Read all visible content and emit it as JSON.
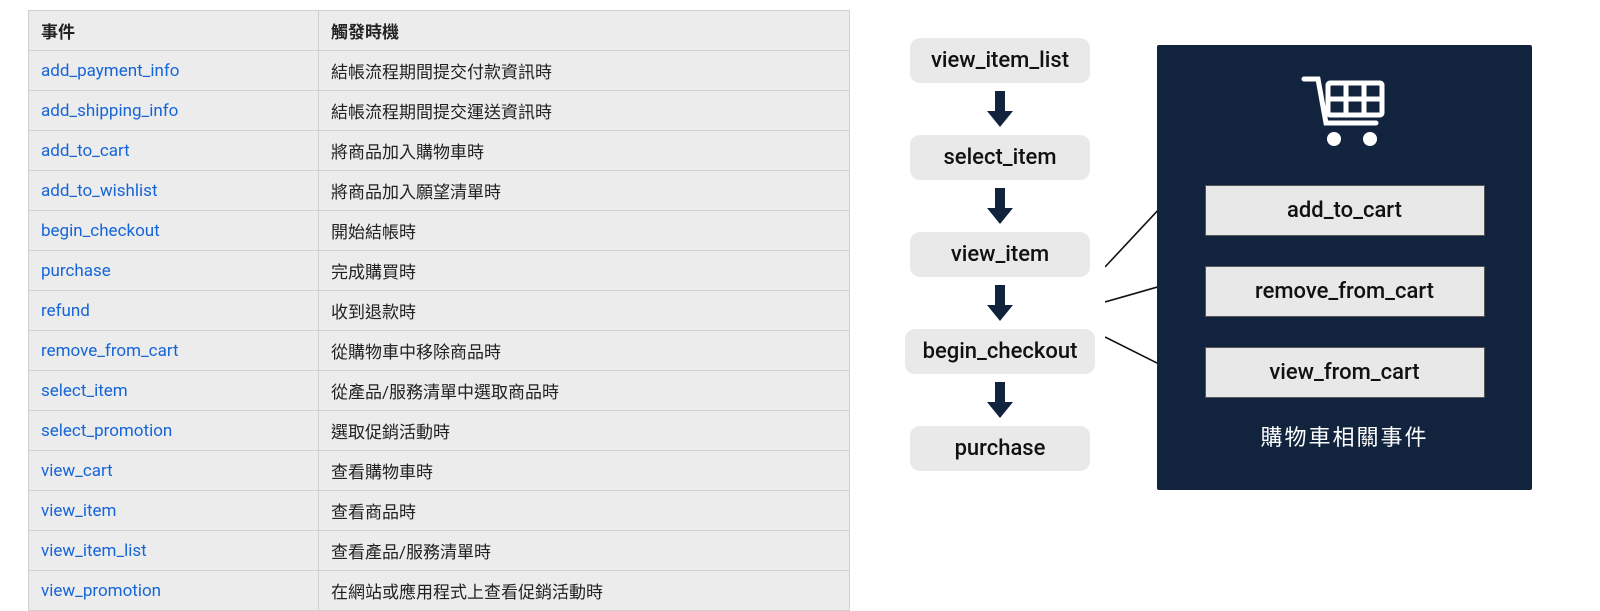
{
  "table": {
    "headers": {
      "event": "事件",
      "trigger": "觸發時機"
    },
    "rows": [
      {
        "event": "add_payment_info",
        "trigger": "結帳流程期間提交付款資訊時"
      },
      {
        "event": "add_shipping_info",
        "trigger": "結帳流程期間提交運送資訊時"
      },
      {
        "event": "add_to_cart",
        "trigger": "將商品加入購物車時"
      },
      {
        "event": "add_to_wishlist",
        "trigger": "將商品加入願望清單時"
      },
      {
        "event": "begin_checkout",
        "trigger": "開始結帳時"
      },
      {
        "event": "purchase",
        "trigger": "完成購買時"
      },
      {
        "event": "refund",
        "trigger": "收到退款時"
      },
      {
        "event": "remove_from_cart",
        "trigger": "從購物車中移除商品時"
      },
      {
        "event": "select_item",
        "trigger": "從產品/服務清單中選取商品時"
      },
      {
        "event": "select_promotion",
        "trigger": "選取促銷活動時"
      },
      {
        "event": "view_cart",
        "trigger": "查看購物車時"
      },
      {
        "event": "view_item",
        "trigger": "查看商品時"
      },
      {
        "event": "view_item_list",
        "trigger": "查看產品/服務清單時"
      },
      {
        "event": "view_promotion",
        "trigger": "在網站或應用程式上查看促銷活動時"
      }
    ]
  },
  "flow": {
    "steps": [
      "view_item_list",
      "select_item",
      "view_item",
      "begin_checkout",
      "purchase"
    ]
  },
  "cart_panel": {
    "title": "購物車相關事件",
    "items": [
      "add_to_cart",
      "remove_from_cart",
      "view_from_cart"
    ]
  }
}
